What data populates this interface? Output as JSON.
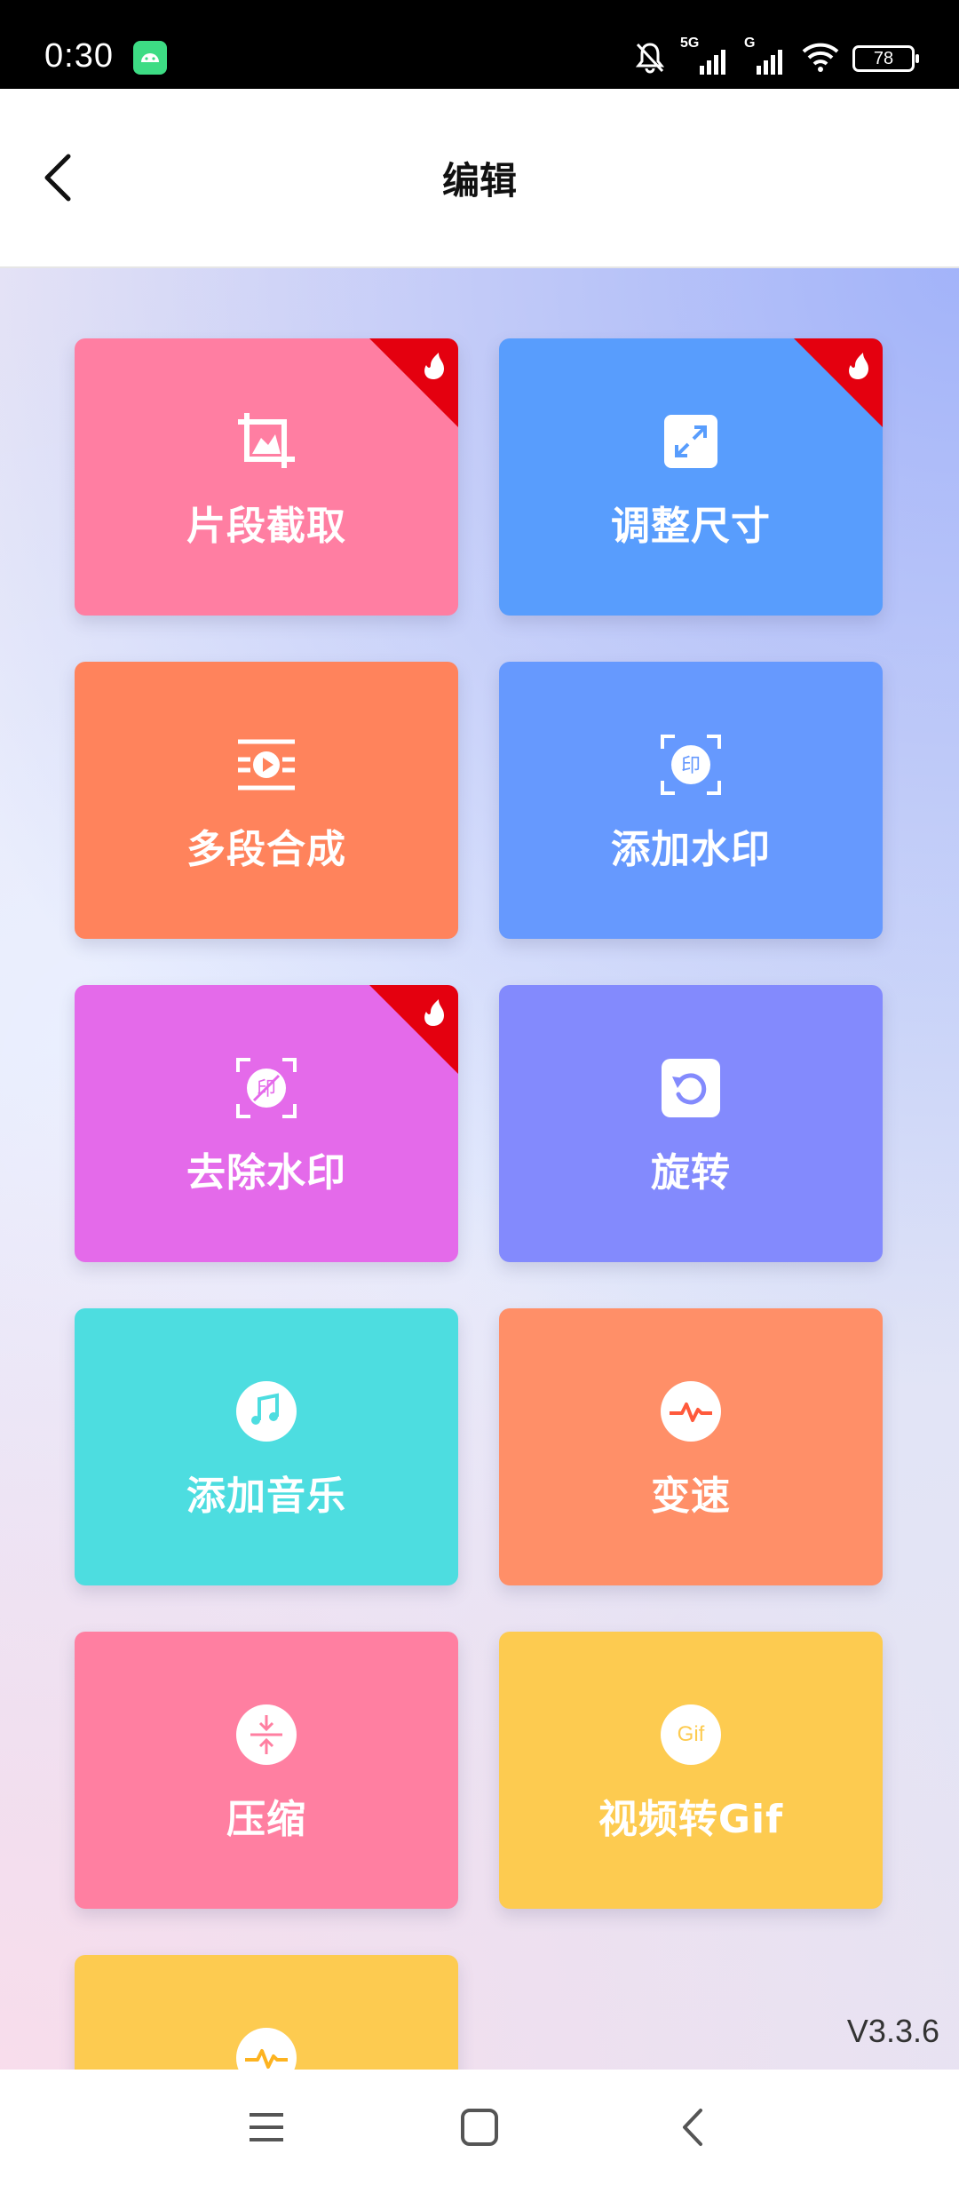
{
  "status_bar": {
    "time": "0:30",
    "network_label": "5G",
    "network_label_2": "G",
    "battery": "78"
  },
  "header": {
    "title": "编辑"
  },
  "tools": [
    {
      "label": "片段截取",
      "color": "#ff7ea2",
      "icon": "crop-icon",
      "hot": true
    },
    {
      "label": "调整尺寸",
      "color": "#589dfd",
      "icon": "resize-icon",
      "hot": true
    },
    {
      "label": "多段合成",
      "color": "#ff835c",
      "icon": "merge-video-icon",
      "hot": false
    },
    {
      "label": "添加水印",
      "color": "#6699fe",
      "icon": "add-watermark-icon",
      "hot": false
    },
    {
      "label": "去除水印",
      "color": "#e46aea",
      "icon": "remove-watermark-icon",
      "hot": true
    },
    {
      "label": "旋转",
      "color": "#838afd",
      "icon": "rotate-icon",
      "hot": false
    },
    {
      "label": "添加音乐",
      "color": "#4ddde0",
      "icon": "music-icon",
      "hot": false
    },
    {
      "label": "变速",
      "color": "#ff8f68",
      "icon": "speed-icon",
      "hot": false
    },
    {
      "label": "压缩",
      "color": "#ff7fa1",
      "icon": "compress-icon",
      "hot": false
    },
    {
      "label": "视频转Gif",
      "color": "#fdcb50",
      "icon": "gif-icon",
      "hot": false,
      "icon_text": "Gif"
    },
    {
      "label": "",
      "color": "#fdcb50",
      "icon": "speed-icon",
      "hot": false
    }
  ],
  "version": "V3.3.6",
  "accent_hot": "#e4000f"
}
